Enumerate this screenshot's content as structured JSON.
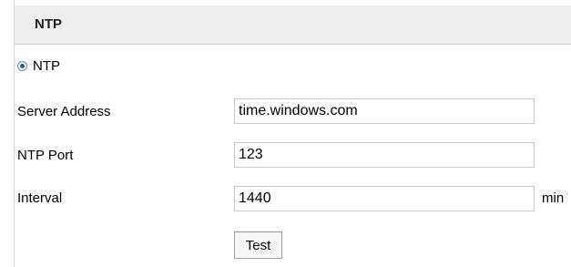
{
  "section": {
    "title": "NTP"
  },
  "ntp_radio": {
    "label": "NTP",
    "checked": true
  },
  "fields": {
    "server_address": {
      "label": "Server Address",
      "value": "time.windows.com"
    },
    "ntp_port": {
      "label": "NTP Port",
      "value": "123"
    },
    "interval": {
      "label": "Interval",
      "value": "1440",
      "unit": "min"
    }
  },
  "buttons": {
    "test_label": "Test"
  },
  "colors": {
    "header_background": "#eeeeee",
    "radio_accent": "#2a5aa8"
  }
}
